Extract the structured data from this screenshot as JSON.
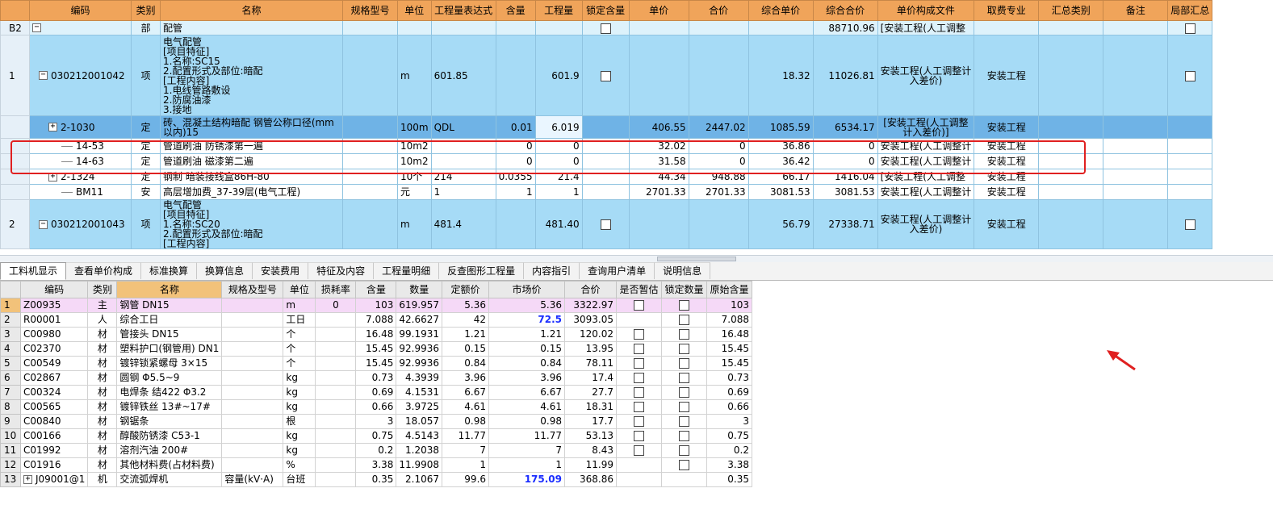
{
  "top_table": {
    "columns": [
      "编码",
      "类别",
      "名称",
      "规格型号",
      "单位",
      "工程量表达式",
      "含量",
      "工程量",
      "锁定含量",
      "单价",
      "合价",
      "综合单价",
      "综合合价",
      "单价构成文件",
      "取费专业",
      "汇总类别",
      "备注",
      "局部汇总"
    ],
    "rows": [
      {
        "no": "B2",
        "code": "",
        "type": "部",
        "name": "配管",
        "spec": "",
        "unit": "",
        "expr": "",
        "content": "",
        "qty": "",
        "unit_price": "",
        "total": "",
        "comp_price": "",
        "comp_total": "88710.96",
        "file": "[安装工程(人工调整",
        "fee": ""
      },
      {
        "no": "1",
        "code": "030212001042",
        "type": "项",
        "name": "电气配管\n[项目特征]\n1.名称:SC15\n2.配置形式及部位:暗配\n[工程内容]\n1.电线管路敷设\n2.防腐油漆\n3.接地",
        "spec": "",
        "unit": "m",
        "expr": "601.85",
        "content": "",
        "qty": "601.9",
        "unit_price": "",
        "total": "",
        "comp_price": "18.32",
        "comp_total": "11026.81",
        "file": "安装工程(人工调整计\n入差价)",
        "fee": "安装工程"
      },
      {
        "no": "",
        "code": "2-1030",
        "type": "定",
        "name": "砖、混凝土结构暗配 钢管公称口径(mm以内)15",
        "spec": "",
        "unit": "100m",
        "expr": "QDL",
        "content": "0.01",
        "qty": "6.019",
        "unit_price": "406.55",
        "total": "2447.02",
        "comp_price": "1085.59",
        "comp_total": "6534.17",
        "file": "[安装工程(人工调整\n计入差价)]",
        "fee": "安装工程"
      },
      {
        "no": "",
        "code": "14-53",
        "type": "定",
        "name": "管道刷油 防锈漆第一遍",
        "spec": "",
        "unit": "10m2",
        "expr": "",
        "content": "0",
        "qty": "0",
        "unit_price": "32.02",
        "total": "0",
        "comp_price": "36.86",
        "comp_total": "0",
        "file": "安装工程(人工调整计",
        "fee": "安装工程"
      },
      {
        "no": "",
        "code": "14-63",
        "type": "定",
        "name": "管道刷油 磁漆第二遍",
        "spec": "",
        "unit": "10m2",
        "expr": "",
        "content": "0",
        "qty": "0",
        "unit_price": "31.58",
        "total": "0",
        "comp_price": "36.42",
        "comp_total": "0",
        "file": "安装工程(人工调整计",
        "fee": "安装工程"
      },
      {
        "no": "",
        "code": "2-1324",
        "type": "定",
        "name": "钢制 暗装接线盒86H-80",
        "spec": "",
        "unit": "10个",
        "expr": "214",
        "content": "0.0355",
        "qty": "21.4",
        "unit_price": "44.34",
        "total": "948.88",
        "comp_price": "66.17",
        "comp_total": "1416.04",
        "file": "[安装工程(人工调整",
        "fee": "安装工程"
      },
      {
        "no": "",
        "code": "BM11",
        "type": "安",
        "name": "高层增加费_37-39层(电气工程)",
        "spec": "",
        "unit": "元",
        "expr": "1",
        "content": "1",
        "qty": "1",
        "unit_price": "2701.33",
        "total": "2701.33",
        "comp_price": "3081.53",
        "comp_total": "3081.53",
        "file": "安装工程(人工调整计",
        "fee": "安装工程"
      },
      {
        "no": "2",
        "code": "030212001043",
        "type": "项",
        "name": "电气配管\n[项目特征]\n1.名称:SC20\n2.配置形式及部位:暗配\n[工程内容]",
        "spec": "",
        "unit": "m",
        "expr": "481.4",
        "content": "",
        "qty": "481.40",
        "unit_price": "",
        "total": "",
        "comp_price": "56.79",
        "comp_total": "27338.71",
        "file": "安装工程(人工调整计\n入差价)",
        "fee": "安装工程"
      }
    ]
  },
  "tabs": [
    "工料机显示",
    "查看单价构成",
    "标准换算",
    "换算信息",
    "安装费用",
    "特征及内容",
    "工程量明细",
    "反查图形工程量",
    "内容指引",
    "查询用户清单",
    "说明信息"
  ],
  "bottom_table": {
    "columns": [
      "编码",
      "类别",
      "名称",
      "规格及型号",
      "单位",
      "损耗率",
      "含量",
      "数量",
      "定额价",
      "市场价",
      "合价",
      "是否暂估",
      "锁定数量",
      "原始含量"
    ],
    "rows": [
      {
        "no": "1",
        "code": "Z00935",
        "type": "主",
        "name": "钢管 DN15",
        "spec": "",
        "unit": "m",
        "loss": "0",
        "content": "103",
        "qty": "619.957",
        "base": "5.36",
        "market": "5.36",
        "total": "3322.97",
        "orig": "103"
      },
      {
        "no": "2",
        "code": "R00001",
        "type": "人",
        "name": "综合工日",
        "spec": "",
        "unit": "工日",
        "loss": "",
        "content": "7.088",
        "qty": "42.6627",
        "base": "42",
        "market": "72.5",
        "total": "3093.05",
        "orig": "7.088"
      },
      {
        "no": "3",
        "code": "C00980",
        "type": "材",
        "name": "管接头 DN15",
        "spec": "",
        "unit": "个",
        "loss": "",
        "content": "16.48",
        "qty": "99.1931",
        "base": "1.21",
        "market": "1.21",
        "total": "120.02",
        "orig": "16.48"
      },
      {
        "no": "4",
        "code": "C02370",
        "type": "材",
        "name": "塑料护口(钢管用) DN1",
        "spec": "",
        "unit": "个",
        "loss": "",
        "content": "15.45",
        "qty": "92.9936",
        "base": "0.15",
        "market": "0.15",
        "total": "13.95",
        "orig": "15.45"
      },
      {
        "no": "5",
        "code": "C00549",
        "type": "材",
        "name": "镀锌锁紧螺母 3×15",
        "spec": "",
        "unit": "个",
        "loss": "",
        "content": "15.45",
        "qty": "92.9936",
        "base": "0.84",
        "market": "0.84",
        "total": "78.11",
        "orig": "15.45"
      },
      {
        "no": "6",
        "code": "C02867",
        "type": "材",
        "name": "圆钢 Φ5.5~9",
        "spec": "",
        "unit": "kg",
        "loss": "",
        "content": "0.73",
        "qty": "4.3939",
        "base": "3.96",
        "market": "3.96",
        "total": "17.4",
        "orig": "0.73"
      },
      {
        "no": "7",
        "code": "C00324",
        "type": "材",
        "name": "电焊条 结422 Φ3.2",
        "spec": "",
        "unit": "kg",
        "loss": "",
        "content": "0.69",
        "qty": "4.1531",
        "base": "6.67",
        "market": "6.67",
        "total": "27.7",
        "orig": "0.69"
      },
      {
        "no": "8",
        "code": "C00565",
        "type": "材",
        "name": "镀锌铁丝 13#~17#",
        "spec": "",
        "unit": "kg",
        "loss": "",
        "content": "0.66",
        "qty": "3.9725",
        "base": "4.61",
        "market": "4.61",
        "total": "18.31",
        "orig": "0.66"
      },
      {
        "no": "9",
        "code": "C00840",
        "type": "材",
        "name": "钢锯条",
        "spec": "",
        "unit": "根",
        "loss": "",
        "content": "3",
        "qty": "18.057",
        "base": "0.98",
        "market": "0.98",
        "total": "17.7",
        "orig": "3"
      },
      {
        "no": "10",
        "code": "C00166",
        "type": "材",
        "name": "醇酸防锈漆 C53-1",
        "spec": "",
        "unit": "kg",
        "loss": "",
        "content": "0.75",
        "qty": "4.5143",
        "base": "11.77",
        "market": "11.77",
        "total": "53.13",
        "orig": "0.75"
      },
      {
        "no": "11",
        "code": "C01992",
        "type": "材",
        "name": "溶剂汽油 200#",
        "spec": "",
        "unit": "kg",
        "loss": "",
        "content": "0.2",
        "qty": "1.2038",
        "base": "7",
        "market": "7",
        "total": "8.43",
        "orig": "0.2"
      },
      {
        "no": "12",
        "code": "C01916",
        "type": "材",
        "name": "其他材料费(占材料费)",
        "spec": "",
        "unit": "%",
        "loss": "",
        "content": "3.38",
        "qty": "11.9908",
        "base": "1",
        "market": "1",
        "total": "11.99",
        "orig": "3.38"
      },
      {
        "no": "13",
        "code": "J09001@1",
        "type": "机",
        "name": "交流弧焊机",
        "spec": "容量(kV·A)",
        "unit": "台班",
        "loss": "",
        "content": "0.35",
        "qty": "2.1067",
        "base": "99.6",
        "market": "175.09",
        "total": "368.86",
        "orig": "0.35"
      }
    ]
  },
  "colors": {
    "annotation_red": "#e02020",
    "header_orange": "#f0a45a",
    "row_blue": "#a6dbf6",
    "selected_blue": "#6fb3e6",
    "price_blue": "#1a2dff"
  }
}
